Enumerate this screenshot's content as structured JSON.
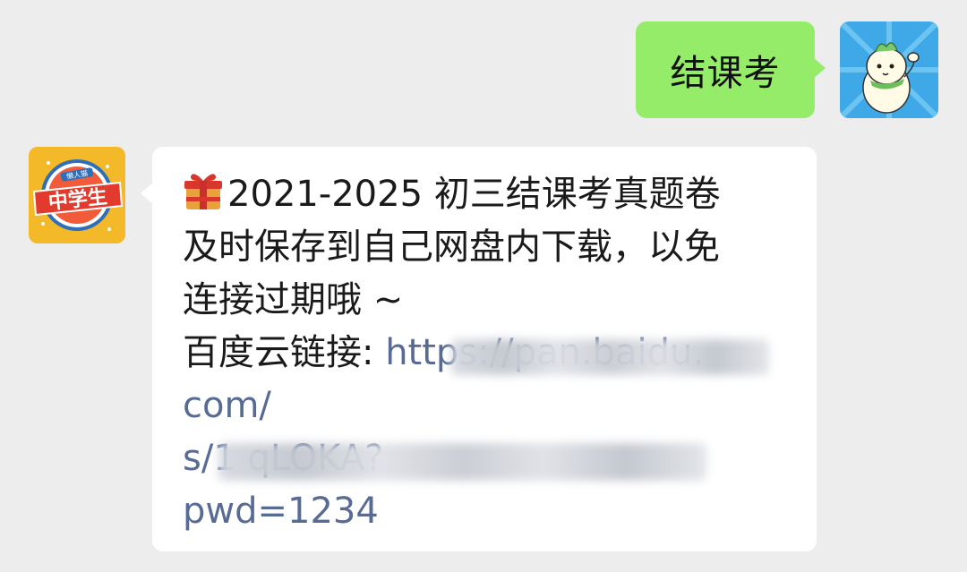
{
  "outgoing": {
    "text": "结课考"
  },
  "incoming": {
    "avatar_text": "中学生",
    "avatar_top_text": "懒人猫",
    "lines": [
      "2021-2025 初三结课考真题卷",
      "及时保存到自己网盘内下载，以免",
      "连接过期哦 ~"
    ],
    "link_prefix": "百度云链接: ",
    "link_line1": "https://pan.baidu.",
    "link_line2": "com/",
    "link_line3": "s/1                            qLOKA?",
    "link_line4": "pwd=1234"
  },
  "colors": {
    "background": "#ededed",
    "outgoing_bubble": "#95ec69",
    "incoming_bubble": "#ffffff",
    "link": "#576b95"
  },
  "icons": [
    "gift-icon",
    "mascot-avatar",
    "middle-school-logo-avatar"
  ]
}
